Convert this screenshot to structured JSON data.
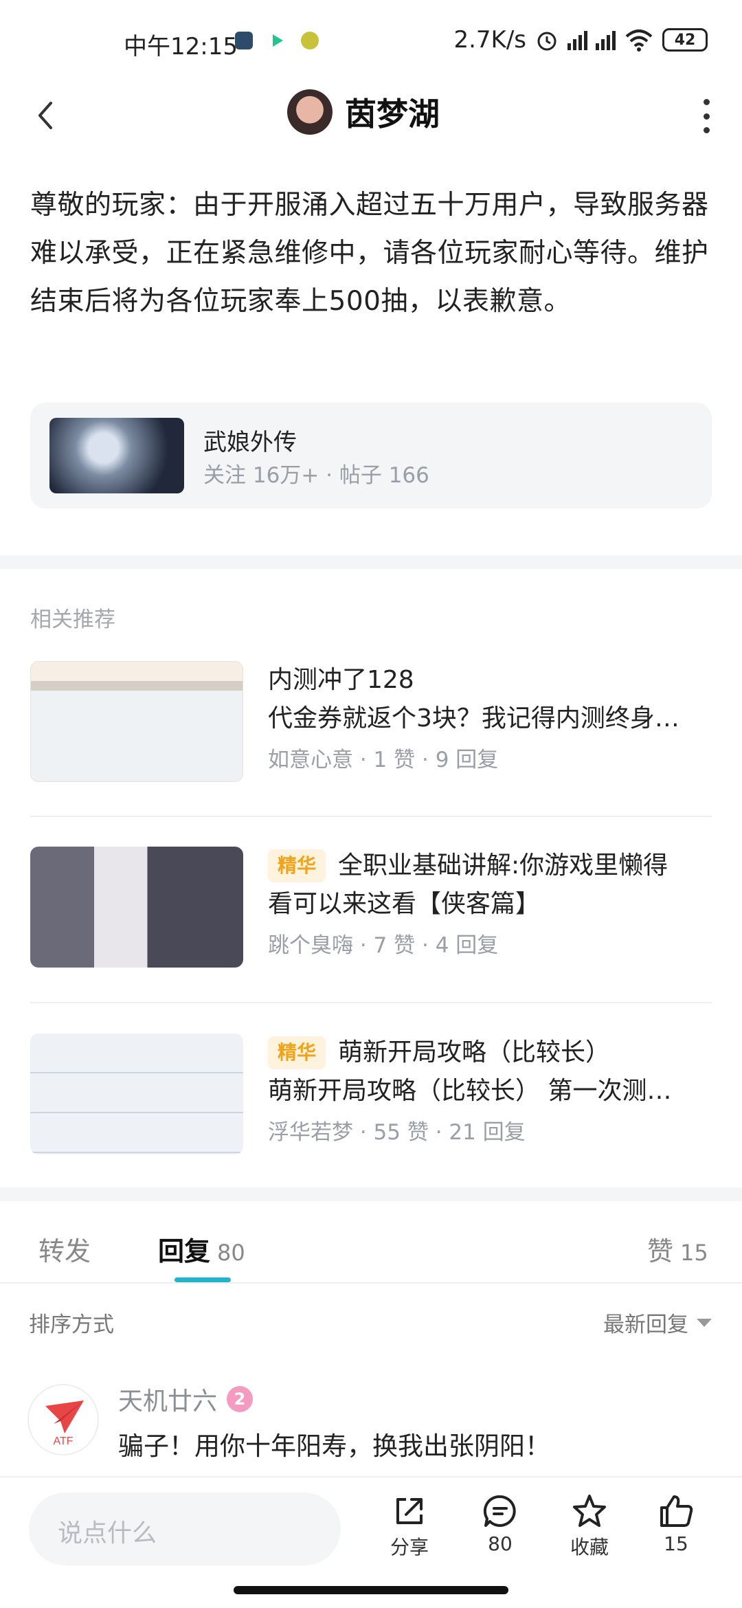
{
  "status": {
    "time": "中午12:15",
    "net_speed": "2.7K/s",
    "battery": "42"
  },
  "header": {
    "title": "茵梦湖"
  },
  "post": {
    "body": "尊敬的玩家：由于开服涌入超过五十万用户，导致服务器难以承受，正在紧急维修中，请各位玩家耐心等待。维护结束后将为各位玩家奉上500抽，以表歉意。"
  },
  "forum": {
    "name": "武娘外传",
    "meta": "关注 16万+  ·  帖子 166"
  },
  "related": {
    "title": "相关推荐",
    "items": [
      {
        "tag": "",
        "line1": "内测冲了128",
        "line2": "代金券就返个3块？我记得内测终身…",
        "meta": "如意心意  ·  1 赞  ·  9 回复"
      },
      {
        "tag": "精华",
        "line1": "全职业基础讲解:你游戏里懒得",
        "line2": "看可以来这看【侠客篇】",
        "meta": "跳个臭嗨  ·  7 赞  ·  4 回复"
      },
      {
        "tag": "精华",
        "line1": "萌新开局攻略（比较长）",
        "line2": "萌新开局攻略（比较长）  第一次测…",
        "meta": "浮华若梦  ·  55 赞  ·  21 回复"
      }
    ]
  },
  "tabs": {
    "forward": "转发",
    "reply": "回复",
    "reply_count": "80",
    "like": "赞",
    "like_count": "15"
  },
  "sort": {
    "label": "排序方式",
    "value": "最新回复"
  },
  "comment": {
    "user": "天机廿六",
    "level": "2",
    "text": "骗子！用你十年阳寿，换我出张阴阳！",
    "avatar_text": "ATF"
  },
  "bottom": {
    "placeholder": "说点什么",
    "share": "分享",
    "comment_count": "80",
    "favorite": "收藏",
    "like_count": "15"
  },
  "colors": {
    "accent": "#22b5c9",
    "tag_bg": "#fff3dd",
    "tag_text": "#f0a31a",
    "level_badge": "#f59ac0",
    "avatar_logo": "#e84545"
  }
}
